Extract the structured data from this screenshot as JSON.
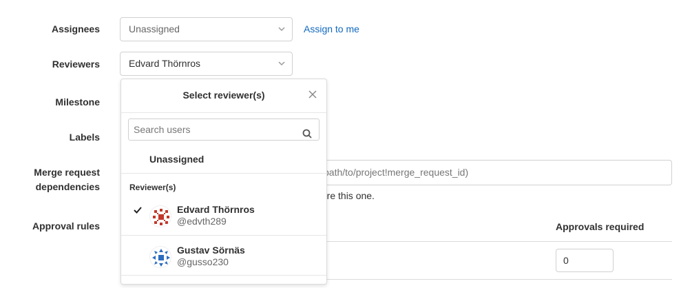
{
  "form": {
    "assignees_label": "Assignees",
    "assignees_value": "Unassigned",
    "assign_to_me": "Assign to me",
    "reviewers_label": "Reviewers",
    "reviewers_value": "Edvard Thörnros",
    "milestone_label": "Milestone",
    "labels_label": "Labels",
    "mr_dep_label_line1": "Merge request",
    "mr_dep_label_line2": "dependencies",
    "mr_dep_placeholder": "path/to/project!merge_request_id)",
    "mr_dep_hint": "fore this one.",
    "approval_rules_label": "Approval rules",
    "approvals_required_label": "Approvals required",
    "approvals_required_value": "0"
  },
  "dropdown": {
    "title": "Select reviewer(s)",
    "search_placeholder": "Search users",
    "unassigned": "Unassigned",
    "section_title": "Reviewer(s)",
    "users": [
      {
        "name": "Edvard Thörnros",
        "handle": "@edvth289",
        "selected": true,
        "avatar_color": "#c0392b"
      },
      {
        "name": "Gustav Sörnäs",
        "handle": "@gusso230",
        "selected": false,
        "avatar_color": "#2b6cc0"
      }
    ]
  },
  "colors": {
    "link": "#1068bf",
    "border": "#d0d0d0"
  }
}
